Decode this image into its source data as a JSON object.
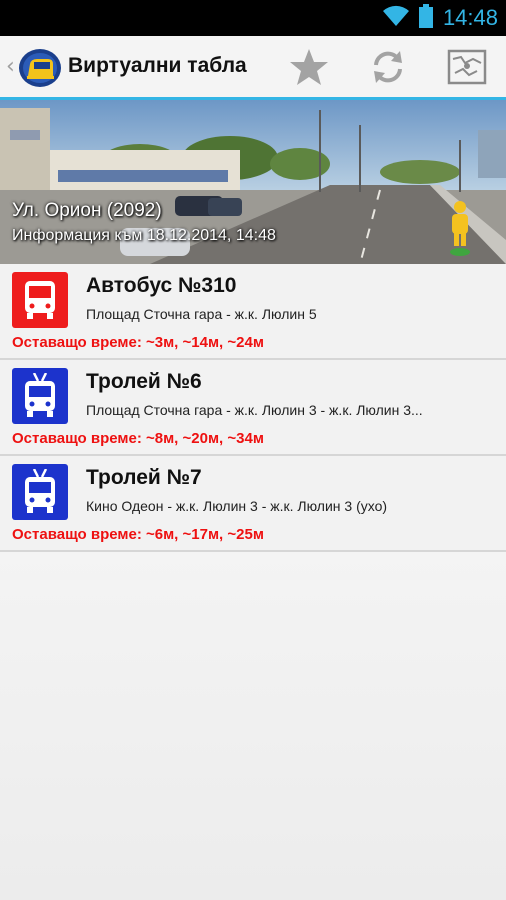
{
  "status_bar": {
    "time": "14:48",
    "icons": [
      "wifi-icon",
      "battery-icon"
    ]
  },
  "action_bar": {
    "title": "Виртуални табла",
    "actions": [
      "star-icon",
      "refresh-icon",
      "map-icon"
    ]
  },
  "banner": {
    "street": "Ул. Орион (2092)",
    "info": "Информация към 18.12.2014, 14:48"
  },
  "colors": {
    "accent": "#33b5e5",
    "bus": "#ee1c1c",
    "trolley": "#1c33cc",
    "time_text": "#ee1111"
  },
  "lines": [
    {
      "type": "bus",
      "icon": "bus-icon",
      "title": "Автобус №310",
      "route": "Площад Сточна гара - ж.к. Люлин 5",
      "times": "Оставащо време: ~3м, ~14м, ~24м"
    },
    {
      "type": "trolley",
      "icon": "trolleybus-icon",
      "title": "Тролей №6",
      "route": "Площад Сточна гара - ж.к. Люлин 3 - ж.к. Люлин 3...",
      "times": "Оставащо време: ~8м, ~20м, ~34м"
    },
    {
      "type": "trolley",
      "icon": "trolleybus-icon",
      "title": "Тролей №7",
      "route": "Кино Одеон - ж.к. Люлин 3 - ж.к. Люлин 3 (ухо)",
      "times": "Оставащо време: ~6м, ~17м, ~25м"
    }
  ]
}
